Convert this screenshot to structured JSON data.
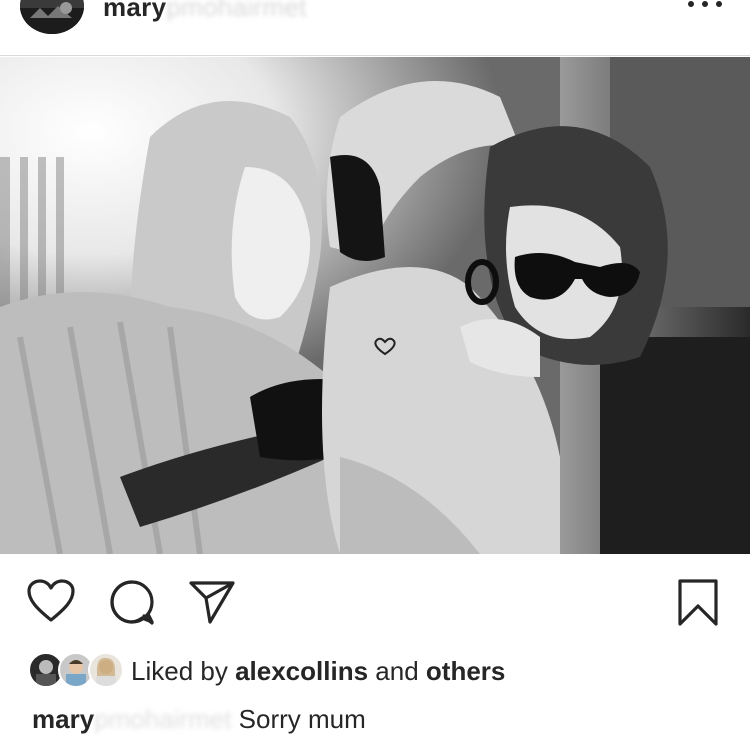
{
  "post": {
    "username": "mary",
    "username_obscured": "pmohairmet",
    "more_icon": "more-horizontal-icon"
  },
  "photo": {
    "description_icon": "photo-image",
    "style": "black-and-white"
  },
  "actions": {
    "like_icon": "heart-outline-icon",
    "comment_icon": "comment-bubble-icon",
    "share_icon": "paper-plane-icon",
    "save_icon": "bookmark-outline-icon"
  },
  "likes": {
    "prefix": "Liked by",
    "user": "alexcollins",
    "middle": "and",
    "others": "others"
  },
  "caption": {
    "username": "mary",
    "username_obscured": "pmohairmet",
    "text": "Sorry mum"
  },
  "colors": {
    "text": "#262626",
    "divider": "#dbdbdb",
    "background": "#ffffff"
  }
}
